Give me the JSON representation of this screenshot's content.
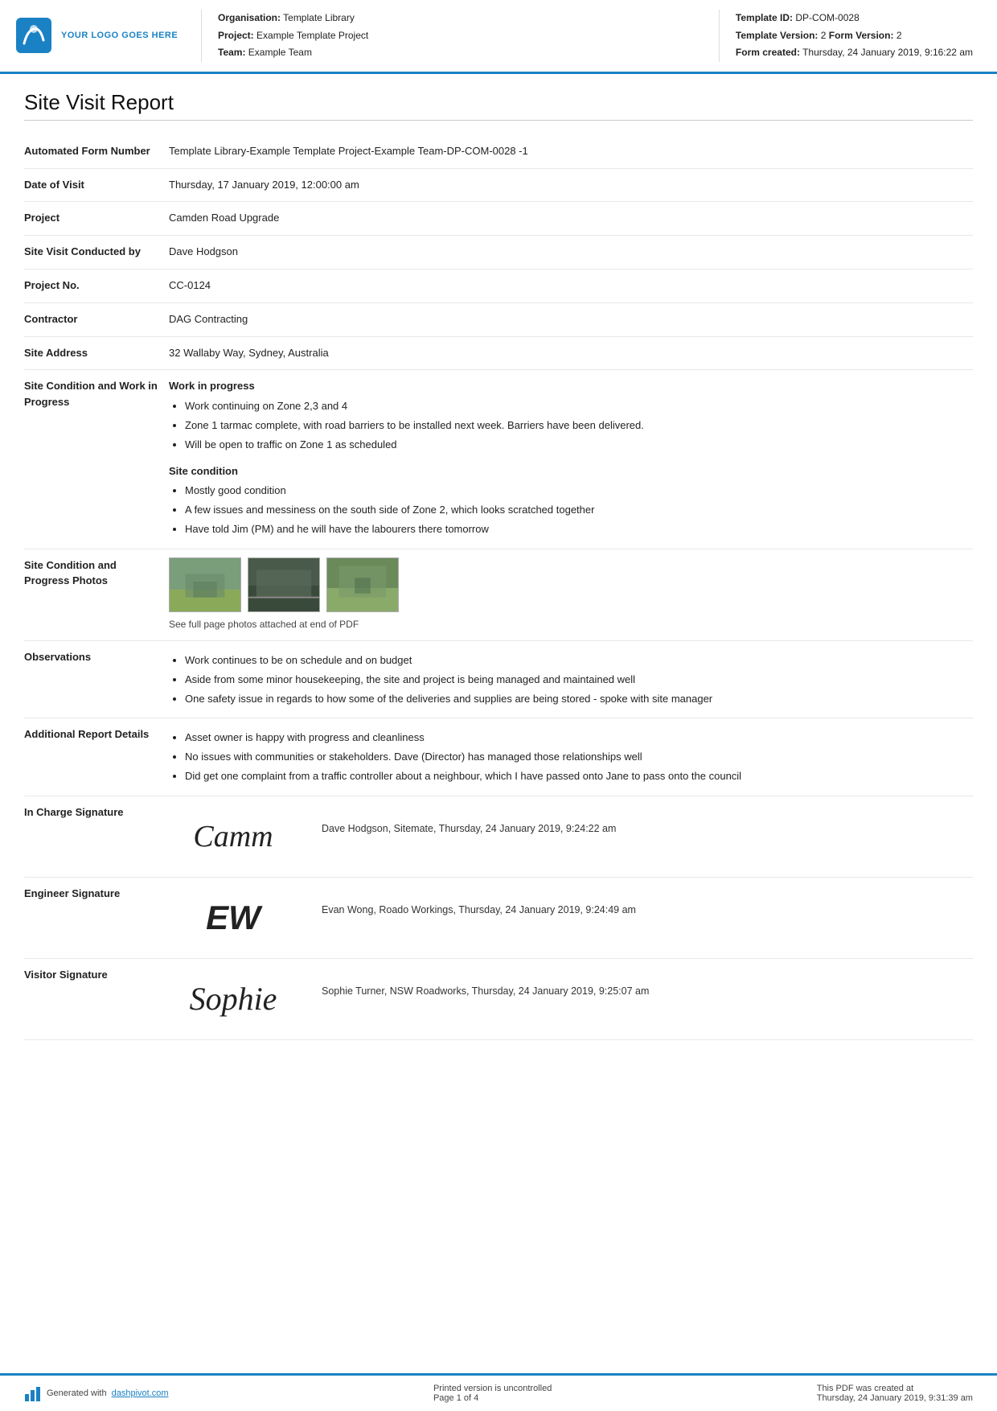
{
  "header": {
    "logo_text": "YOUR LOGO GOES HERE",
    "org_label": "Organisation:",
    "org_value": "Template Library",
    "project_label": "Project:",
    "project_value": "Example Template Project",
    "team_label": "Team:",
    "team_value": "Example Team",
    "template_id_label": "Template ID:",
    "template_id_value": "DP-COM-0028",
    "template_version_label": "Template Version:",
    "template_version_value": "2",
    "form_version_label": "Form Version:",
    "form_version_value": "2",
    "form_created_label": "Form created:",
    "form_created_value": "Thursday, 24 January 2019, 9:16:22 am"
  },
  "report": {
    "title": "Site Visit Report",
    "fields": {
      "automated_label": "Automated Form Number",
      "automated_value": "Template Library-Example Template Project-Example Team-DP-COM-0028   -1",
      "date_label": "Date of Visit",
      "date_value": "Thursday, 17 January 2019, 12:00:00 am",
      "project_label": "Project",
      "project_value": "Camden Road Upgrade",
      "site_visit_label": "Site Visit Conducted by",
      "site_visit_value": "Dave Hodgson",
      "project_no_label": "Project No.",
      "project_no_value": "CC-0124",
      "contractor_label": "Contractor",
      "contractor_value": "DAG Contracting",
      "site_address_label": "Site Address",
      "site_address_value": "32 Wallaby Way, Sydney, Australia",
      "site_condition_label": "Site Condition and Work in Progress",
      "work_heading": "Work in progress",
      "work_items": [
        "Work continuing on Zone 2,3 and 4",
        "Zone 1 tarmac complete, with road barriers to be installed next week. Barriers have been delivered.",
        "Will be open to traffic on Zone 1 as scheduled"
      ],
      "site_condition_heading": "Site condition",
      "site_condition_items": [
        "Mostly good condition",
        "A few issues and messiness on the south side of Zone 2, which looks scratched together",
        "Have told Jim (PM) and he will have the labourers there tomorrow"
      ],
      "photos_label": "Site Condition and Progress Photos",
      "photos_caption": "See full page photos attached at end of PDF",
      "observations_label": "Observations",
      "observations_items": [
        "Work continues to be on schedule and on budget",
        "Aside from some minor housekeeping, the site and project is being managed and maintained well",
        "One safety issue in regards to how some of the deliveries and supplies are being stored - spoke with site manager"
      ],
      "additional_label": "Additional Report Details",
      "additional_items": [
        "Asset owner is happy with progress and cleanliness",
        "No issues with communities or stakeholders. Dave (Director) has managed those relationships well",
        "Did get one complaint from a traffic controller about a neighbour, which I have passed onto Jane to pass onto the council"
      ],
      "in_charge_label": "In Charge Signature",
      "in_charge_sig": "Cam",
      "in_charge_info": "Dave Hodgson, Sitemate, Thursday, 24 January 2019, 9:24:22 am",
      "engineer_label": "Engineer Signature",
      "engineer_sig": "EW",
      "engineer_info": "Evan Wong, Roado Workings, Thursday, 24 January 2019, 9:24:49 am",
      "visitor_label": "Visitor Signature",
      "visitor_sig": "Sophie",
      "visitor_info": "Sophie Turner, NSW Roadworks, Thursday, 24 January 2019, 9:25:07 am"
    }
  },
  "footer": {
    "generated_text": "Generated with ",
    "link_text": "dashpivot.com",
    "print_text": "Printed version is uncontrolled",
    "page_text": "Page 1 of 4",
    "created_text": "This PDF was created at",
    "created_date": "Thursday, 24 January 2019, 9:31:39 am"
  }
}
